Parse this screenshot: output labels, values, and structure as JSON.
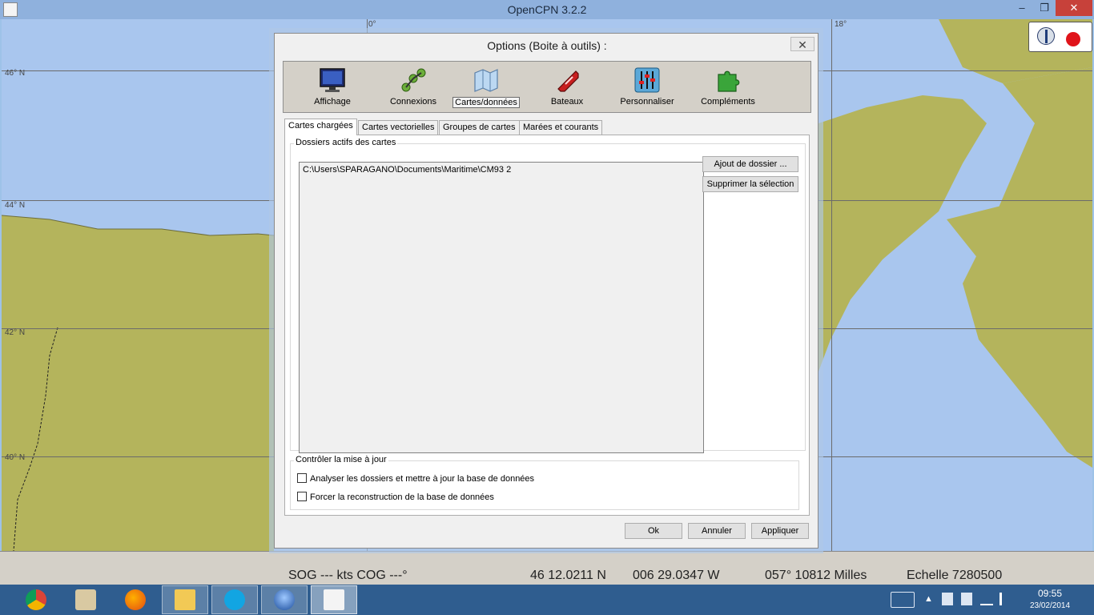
{
  "app": {
    "title": "OpenCPN 3.2.2",
    "window_controls": {
      "minimize": "‒",
      "maximize": "❐",
      "close": "✕"
    }
  },
  "map": {
    "lat_labels": [
      "46° N",
      "44° N",
      "42° N",
      "40° N"
    ],
    "top_label": "0°",
    "top_label_right": "18°",
    "colors": {
      "sea": "#a9c6ee",
      "land": "#b4b45c",
      "grid": "#6b6b6b"
    }
  },
  "dialog": {
    "title": "Options (Boite à outils) :",
    "close": "✕",
    "toolbox": [
      {
        "label": "Affichage",
        "icon": "monitor-icon"
      },
      {
        "label": "Connexions",
        "icon": "connections-icon"
      },
      {
        "label": "Cartes/données",
        "icon": "charts-icon"
      },
      {
        "label": "Bateaux",
        "icon": "ship-icon"
      },
      {
        "label": "Personnaliser",
        "icon": "sliders-icon"
      },
      {
        "label": "Compléments",
        "icon": "puzzle-icon"
      }
    ],
    "tabs": [
      "Cartes chargées",
      "Cartes vectorielles",
      "Groupes de cartes",
      "Marées et courants"
    ],
    "active_dirs_label": "Dossiers actifs des cartes",
    "dir_list": [
      "C:\\Users\\SPARAGANO\\Documents\\Maritime\\CM93 2"
    ],
    "add_dir_button": "Ajout de dossier ...",
    "remove_selection_button": "Supprimer la sélection",
    "update_group_label": "Contrôler la mise à jour",
    "scan_checkbox": "Analyser les dossiers et mettre à jour la base de données",
    "force_checkbox": "Forcer la reconstruction de la base de données",
    "ok_button": "Ok",
    "cancel_button": "Annuler",
    "apply_button": "Appliquer"
  },
  "status": {
    "sog_cog": "SOG --- kts  COG ---°",
    "lat": "46 12.0211 N",
    "lon": "006 29.0347 W",
    "bearing_distance": "057°  10812 Milles",
    "scale": "Echelle 7280500"
  },
  "taskbar": {
    "time": "09:55",
    "date": "23/02/2014"
  }
}
